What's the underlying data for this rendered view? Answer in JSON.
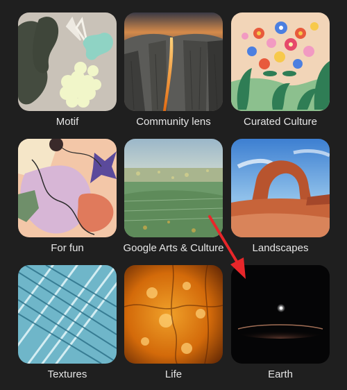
{
  "collections": [
    {
      "label": "Motif",
      "icon": "motif-abstract-art"
    },
    {
      "label": "Community lens",
      "icon": "firefall-cliff-photo"
    },
    {
      "label": "Curated Culture",
      "icon": "floral-illustration"
    },
    {
      "label": "For fun",
      "icon": "playful-illustration"
    },
    {
      "label": "Google Arts & Culture",
      "icon": "aerial-landscape-art"
    },
    {
      "label": "Landscapes",
      "icon": "desert-arch-photo"
    },
    {
      "label": "Textures",
      "icon": "glass-lattice-photo"
    },
    {
      "label": "Life",
      "icon": "amber-macro-photo"
    },
    {
      "label": "Earth",
      "icon": "earth-horizon-space"
    }
  ],
  "annotation": {
    "arrow_color": "#e8262a"
  }
}
